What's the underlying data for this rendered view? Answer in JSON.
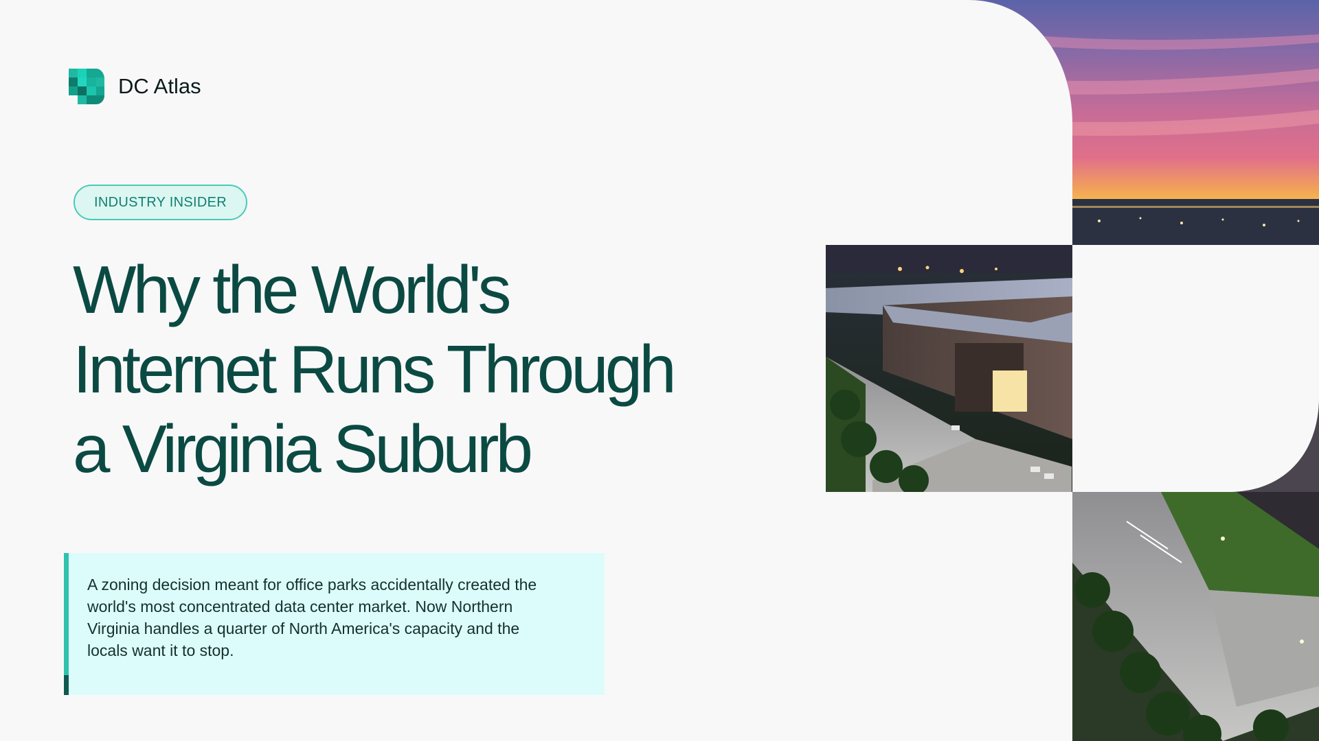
{
  "brand": {
    "name": "DC Atlas",
    "accent": "#1fb9a3",
    "accent_dark": "#0b4a42"
  },
  "tag": {
    "label": "INDUSTRY INSIDER"
  },
  "article": {
    "title_lines": [
      "Why the World's",
      "Internet Runs Through",
      "a Virginia Suburb"
    ],
    "summary": "A zoning decision meant for office parks accidentally created the world's most concentrated data center market. Now Northern Virginia handles a quarter of North America's capacity and the locals want it to stop."
  },
  "icons": {
    "logo": "dc-atlas-logo-icon"
  },
  "colors": {
    "background": "#f8f8f9",
    "headline": "#0b4a42",
    "tag_border": "#4cc9b5",
    "tag_fill": "#dcf6f2",
    "callout_fill": "#dcfcfb"
  }
}
